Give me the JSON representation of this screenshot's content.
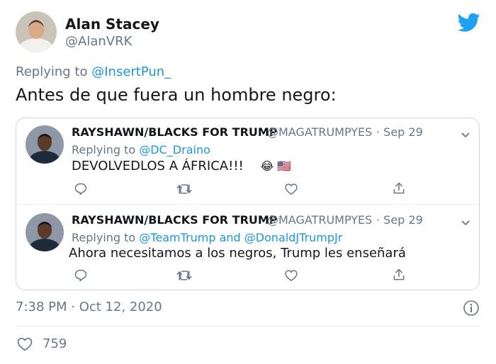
{
  "tweet": {
    "display_name": "Alan Stacey",
    "username": "@AlanVRK",
    "replying_prefix": "Replying to",
    "replying_handle": "@InsertPun_",
    "text": "Antes de que fuera un hombre negro:",
    "timestamp": "7:38 PM · Oct 12, 2020",
    "like_count": "759"
  },
  "quoted": [
    {
      "author": "RAYSHAWN/BLACKS FOR TRUMP",
      "handle": "@MAGATRUMPYES",
      "date": "· Sep 29",
      "replying_prefix": "Replying to",
      "replying_to": "@DC_Draino",
      "text": "DEVOLVEDLOS A ÁFRICA!!!",
      "emoji": "😂 🇺🇸"
    },
    {
      "author": "RAYSHAWN/BLACKS FOR TRUMP",
      "handle": "@MAGATRUMPYES",
      "date": "· Sep 29",
      "replying_prefix": "Replying to",
      "replying_to_a": "@TeamTrump",
      "replying_and": "and",
      "replying_to_b": "@DonaldJTrumpJr",
      "text": "Ahora necesitamos a los negros, Trump les enseñará"
    }
  ],
  "icons": {
    "brand": "twitter-bird-icon",
    "reply": "reply-icon",
    "retweet": "retweet-icon",
    "like": "heart-icon",
    "share": "share-icon",
    "info": "info-icon",
    "menu": "chevron-down-icon"
  },
  "colors": {
    "brand_blue": "#1da1f2",
    "link_blue": "#1b95e0",
    "muted_gray": "#657786",
    "border": "#ccd6dd"
  }
}
